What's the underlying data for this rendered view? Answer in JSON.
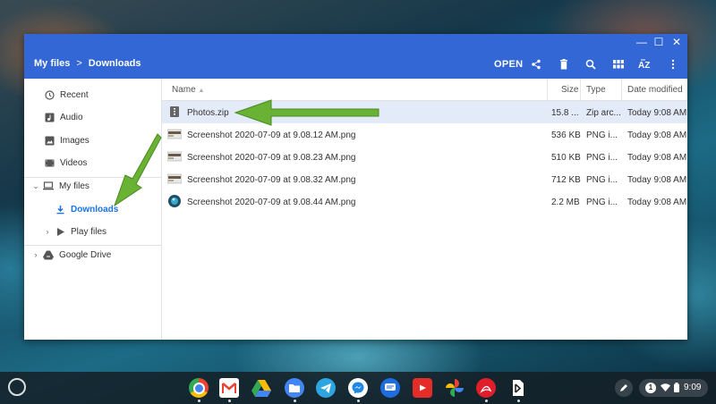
{
  "window": {
    "breadcrumb": [
      "My files",
      "Downloads"
    ],
    "breadcrumb_sep": ">",
    "toolbar": {
      "open_label": "OPEN"
    },
    "controls": {
      "minimize": "—",
      "maximize": "☐",
      "close": "✕"
    }
  },
  "sidebar": {
    "items": [
      {
        "label": "Recent",
        "icon": "clock-icon"
      },
      {
        "label": "Audio",
        "icon": "audio-icon"
      },
      {
        "label": "Images",
        "icon": "image-icon"
      },
      {
        "label": "Videos",
        "icon": "video-icon"
      },
      {
        "label": "My files",
        "icon": "laptop-icon"
      },
      {
        "label": "Downloads",
        "icon": "download-icon"
      },
      {
        "label": "Play files",
        "icon": "play-icon"
      },
      {
        "label": "Google Drive",
        "icon": "drive-icon"
      }
    ]
  },
  "file_list": {
    "columns": {
      "name": "Name",
      "size": "Size",
      "type": "Type",
      "modified": "Date modified"
    },
    "sort_indicator": "▲",
    "rows": [
      {
        "name": "Photos.zip",
        "size": "15.8 ...",
        "type": "Zip arc...",
        "modified": "Today 9:08 AM"
      },
      {
        "name": "Screenshot 2020-07-09 at 9.08.12 AM.png",
        "size": "536 KB",
        "type": "PNG i...",
        "modified": "Today 9:08 AM"
      },
      {
        "name": "Screenshot 2020-07-09 at 9.08.23 AM.png",
        "size": "510 KB",
        "type": "PNG i...",
        "modified": "Today 9:08 AM"
      },
      {
        "name": "Screenshot 2020-07-09 at 9.08.32 AM.png",
        "size": "712 KB",
        "type": "PNG i...",
        "modified": "Today 9:08 AM"
      },
      {
        "name": "Screenshot 2020-07-09 at 9.08.44 AM.png",
        "size": "2.2 MB",
        "type": "PNG i...",
        "modified": "Today 9:08 AM"
      }
    ]
  },
  "shelf": {
    "tray": {
      "notification_count": "1",
      "time": "9:09"
    }
  },
  "colors": {
    "accent": "#3367d6",
    "selected_row": "#e3eaf8",
    "annotation_arrow": "#6ab234"
  }
}
